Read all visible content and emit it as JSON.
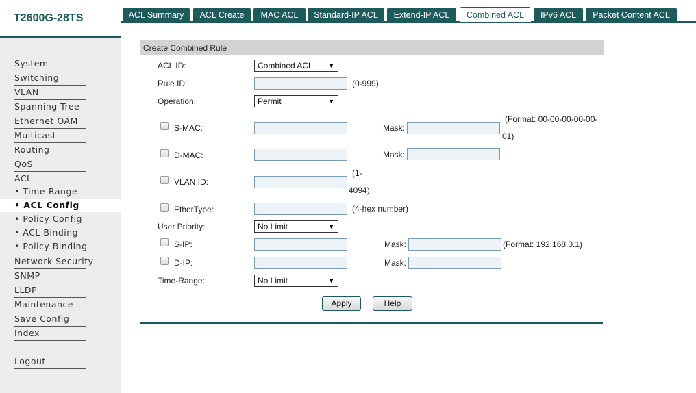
{
  "brand": "T2600G-28TS",
  "sidebar": {
    "items": [
      {
        "label": "System"
      },
      {
        "label": "Switching"
      },
      {
        "label": "VLAN"
      },
      {
        "label": "Spanning Tree"
      },
      {
        "label": "Ethernet OAM"
      },
      {
        "label": "Multicast"
      },
      {
        "label": "Routing"
      },
      {
        "label": "QoS"
      },
      {
        "label": "ACL"
      }
    ],
    "acl_sub": [
      {
        "label": "• Time-Range"
      },
      {
        "label": "• ACL Config"
      },
      {
        "label": "• Policy Config"
      },
      {
        "label": "• ACL Binding"
      },
      {
        "label": "• Policy Binding"
      }
    ],
    "items2": [
      {
        "label": "Network Security"
      },
      {
        "label": "SNMP"
      },
      {
        "label": "LLDP"
      },
      {
        "label": "Maintenance"
      },
      {
        "label": "Save Config"
      },
      {
        "label": "Index"
      }
    ],
    "logout": "Logout",
    "active": "• ACL Config"
  },
  "tabs": [
    {
      "label": "ACL Summary"
    },
    {
      "label": "ACL Create"
    },
    {
      "label": "MAC ACL"
    },
    {
      "label": "Standard-IP ACL"
    },
    {
      "label": "Extend-IP ACL"
    },
    {
      "label": "Combined ACL"
    },
    {
      "label": "IPv6 ACL"
    },
    {
      "label": "Packet Content ACL"
    }
  ],
  "active_tab": "Combined ACL",
  "panel": {
    "title": "Create Combined Rule",
    "acl_id": {
      "label": "ACL ID:",
      "value": "Combined ACL"
    },
    "rule_id": {
      "label": "Rule ID:",
      "value": "",
      "hint": "(0-999)"
    },
    "operation": {
      "label": "Operation:",
      "value": "Permit"
    },
    "smac": {
      "label": "S-MAC:",
      "value": "",
      "mask_label": "Mask:",
      "mask_value": "",
      "hint_line1": "(Format: 00-00-00-00-00-",
      "hint_line2": "01)",
      "checked": false
    },
    "dmac": {
      "label": "D-MAC:",
      "value": "",
      "mask_label": "Mask:",
      "mask_value": "",
      "checked": false
    },
    "vlan": {
      "label": "VLAN ID:",
      "value": "",
      "hint_line1": "(1-",
      "hint_line2": "4094)",
      "checked": false
    },
    "ethertype": {
      "label": "EtherType:",
      "value": "",
      "hint": "(4-hex number)",
      "checked": false
    },
    "user_priority": {
      "label": "User Priority:",
      "value": "No Limit"
    },
    "sip": {
      "label": "S-IP:",
      "value": "",
      "mask_label": "Mask:",
      "mask_value": "",
      "hint": "(Format: 192.168.0.1)",
      "checked": false
    },
    "dip": {
      "label": "D-IP:",
      "value": "",
      "mask_label": "Mask:",
      "mask_value": "",
      "checked": false
    },
    "time_range": {
      "label": "Time-Range:",
      "value": "No Limit"
    },
    "apply_label": "Apply",
    "help_label": "Help"
  },
  "colors": {
    "accent": "#1c5a5c",
    "sidebar_bg": "#ececec",
    "panel_head_bg": "#d3d3d3",
    "input_bg": "#edf2f7"
  },
  "icons": {
    "dropdown": "triangle-down-icon"
  }
}
